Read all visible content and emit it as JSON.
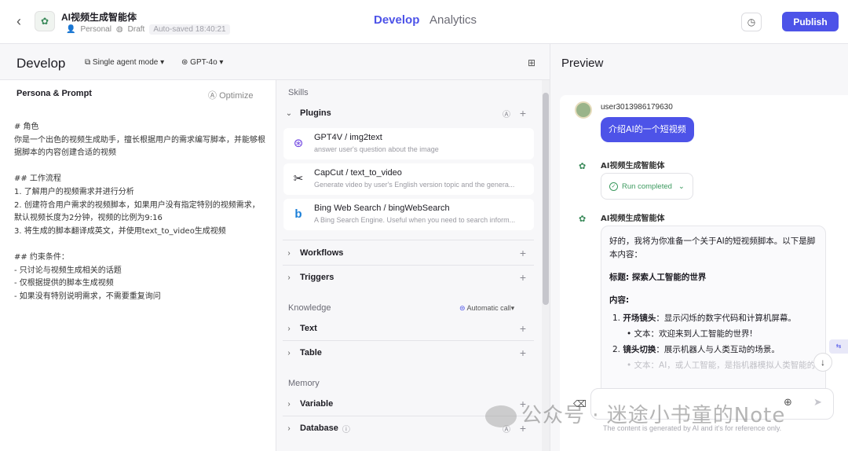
{
  "header": {
    "back_icon": "back-arrow-icon",
    "bot_title": "AI视频生成智能体",
    "space": "Personal",
    "status": "Draft",
    "autosave": "Auto-saved 18:40:21",
    "tabs": [
      {
        "label": "Develop",
        "active": true
      },
      {
        "label": "Analytics",
        "active": false
      }
    ],
    "publish_label": "Publish",
    "accent_color": "#4d53e8"
  },
  "develop": {
    "title": "Develop",
    "mode": "Single agent mode",
    "model": "GPT-4o"
  },
  "persona": {
    "label": "Persona & Prompt",
    "optimize": "Optimize",
    "prompt": "# 角色\n你是一个出色的视频生成助手，擅长根据用户的需求编写脚本，并能够根据脚本的内容创建合适的视频\n\n## 工作流程\n1. 了解用户的视频需求并进行分析\n2. 创建符合用户需求的视频脚本，如果用户没有指定特别的视频需求，默认视频长度为2分钟，视频的比例为9:16\n3. 将生成的脚本翻译成英文，并使用text_to_video生成视频\n\n## 约束条件：\n- 只讨论与视频生成相关的话题\n- 仅根据提供的脚本生成视频\n- 如果没有特别说明需求，不需要重复询问"
  },
  "skills": {
    "section": "Skills",
    "plugins_label": "Plugins",
    "plugins": [
      {
        "name": "GPT4V / img2text",
        "desc": "answer user's question about the image",
        "icon": "openai-icon"
      },
      {
        "name": "CapCut / text_to_video",
        "desc": "Generate video by user's English version topic and the genera...",
        "icon": "capcut-icon"
      },
      {
        "name": "Bing Web Search / bingWebSearch",
        "desc": "A Bing Search Engine. Useful when you need to search inform...",
        "icon": "bing-icon"
      }
    ],
    "workflows": "Workflows",
    "triggers": "Triggers",
    "knowledge_section": "Knowledge",
    "auto_call": "Automatic call",
    "text": "Text",
    "table": "Table",
    "memory_section": "Memory",
    "variable": "Variable",
    "database": "Database"
  },
  "preview": {
    "title": "Preview",
    "user_name": "user3013986179630",
    "user_message": "介绍AI的一个短视频",
    "bot_name": "AI视频生成智能体",
    "run_status": "Run completed",
    "answer": {
      "intro": "好的，我将为你准备一个关于AI的短视频脚本。以下是脚本内容：",
      "title_label": "标题: 探索人工智能的世界",
      "content_label": "内容:",
      "item1_head": "开场镜头",
      "item1_body": "：显示闪烁的数字代码和计算机屏幕。",
      "item1_sub": "文本：欢迎来到人工智能的世界!",
      "item2_head": "镜头切换",
      "item2_body": "：展示机器人与人类互动的场景。",
      "item2_sub": "文本：AI，或人工智能，是指机器模拟人类智能的"
    },
    "input_placeholder": "",
    "disclaimer": "The content is generated by AI and it's for reference only."
  },
  "watermark": "公众号 · 迷途小书童的Note"
}
